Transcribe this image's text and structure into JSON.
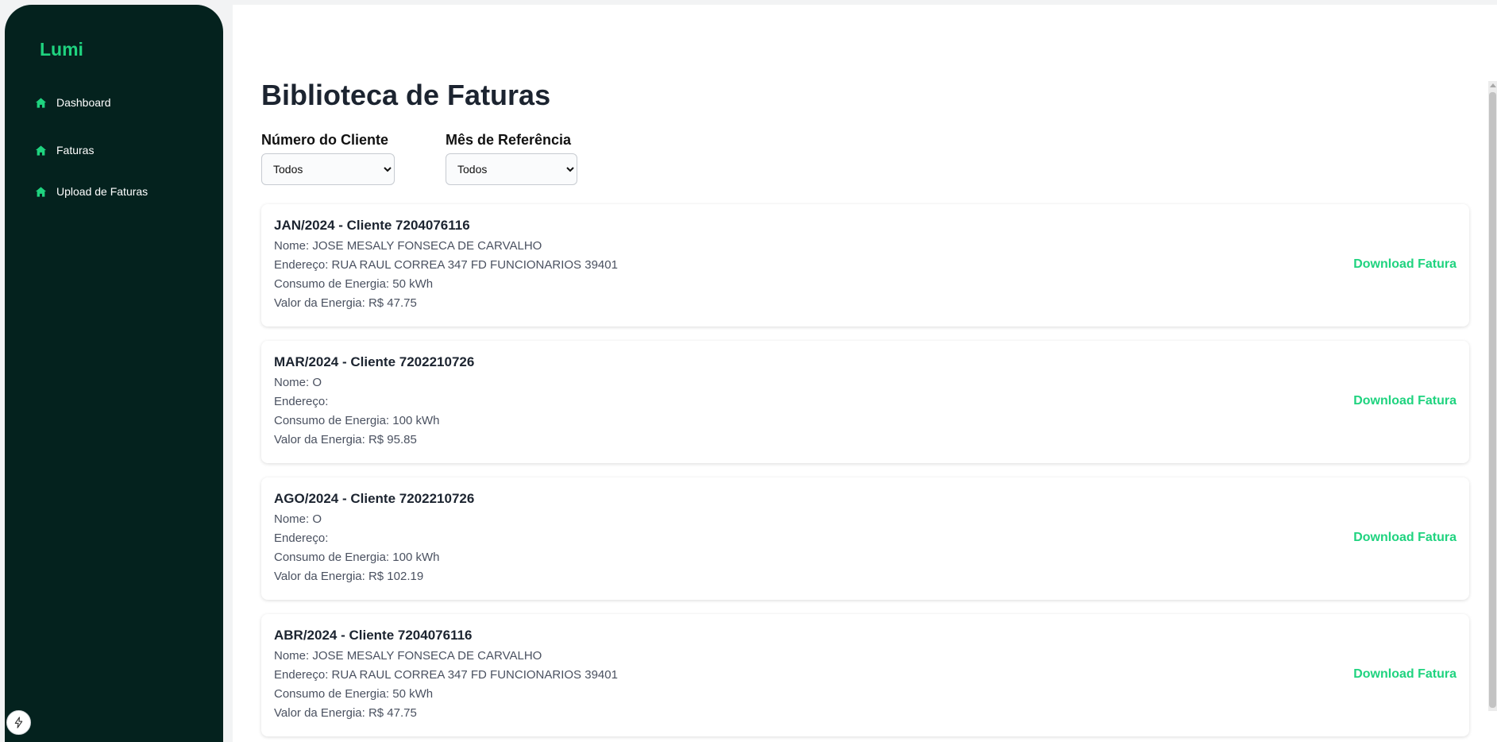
{
  "sidebar": {
    "brand": "Lumi",
    "items": [
      {
        "icon": "home-icon",
        "label": "Dashboard"
      },
      {
        "icon": "home-icon",
        "label": "Faturas"
      },
      {
        "icon": "home-icon",
        "label": "Upload de Faturas"
      }
    ],
    "badge_icon": "lightning-icon"
  },
  "main": {
    "title": "Biblioteca de Faturas",
    "filters": {
      "client_label": "Número do Cliente",
      "client_value": "Todos",
      "month_label": "Mês de Referência",
      "month_value": "Todos"
    },
    "invoices": [
      {
        "title": "JAN/2024 - Cliente 7204076116",
        "name": "Nome: JOSE MESALY FONSECA DE CARVALHO",
        "address": "Endereço: RUA RAUL CORREA 347 FD FUNCIONARIOS 39401",
        "consumption": "Consumo de Energia: 50 kWh",
        "value": "Valor da Energia: R$ 47.75",
        "download": "Download Fatura"
      },
      {
        "title": "MAR/2024 - Cliente 7202210726",
        "name": "Nome: O",
        "address": "Endereço:",
        "consumption": "Consumo de Energia: 100 kWh",
        "value": "Valor da Energia: R$ 95.85",
        "download": "Download Fatura"
      },
      {
        "title": "AGO/2024 - Cliente 7202210726",
        "name": "Nome: O",
        "address": "Endereço:",
        "consumption": "Consumo de Energia: 100 kWh",
        "value": "Valor da Energia: R$ 102.19",
        "download": "Download Fatura"
      },
      {
        "title": "ABR/2024 - Cliente 7204076116",
        "name": "Nome: JOSE MESALY FONSECA DE CARVALHO",
        "address": "Endereço: RUA RAUL CORREA 347 FD FUNCIONARIOS 39401",
        "consumption": "Consumo de Energia: 50 kWh",
        "value": "Valor da Energia: R$ 47.75",
        "download": "Download Fatura"
      }
    ]
  },
  "colors": {
    "sidebar_bg": "#04221e",
    "accent": "#1fd37f",
    "title_text": "#1c2430",
    "body_text": "#4a5160"
  }
}
